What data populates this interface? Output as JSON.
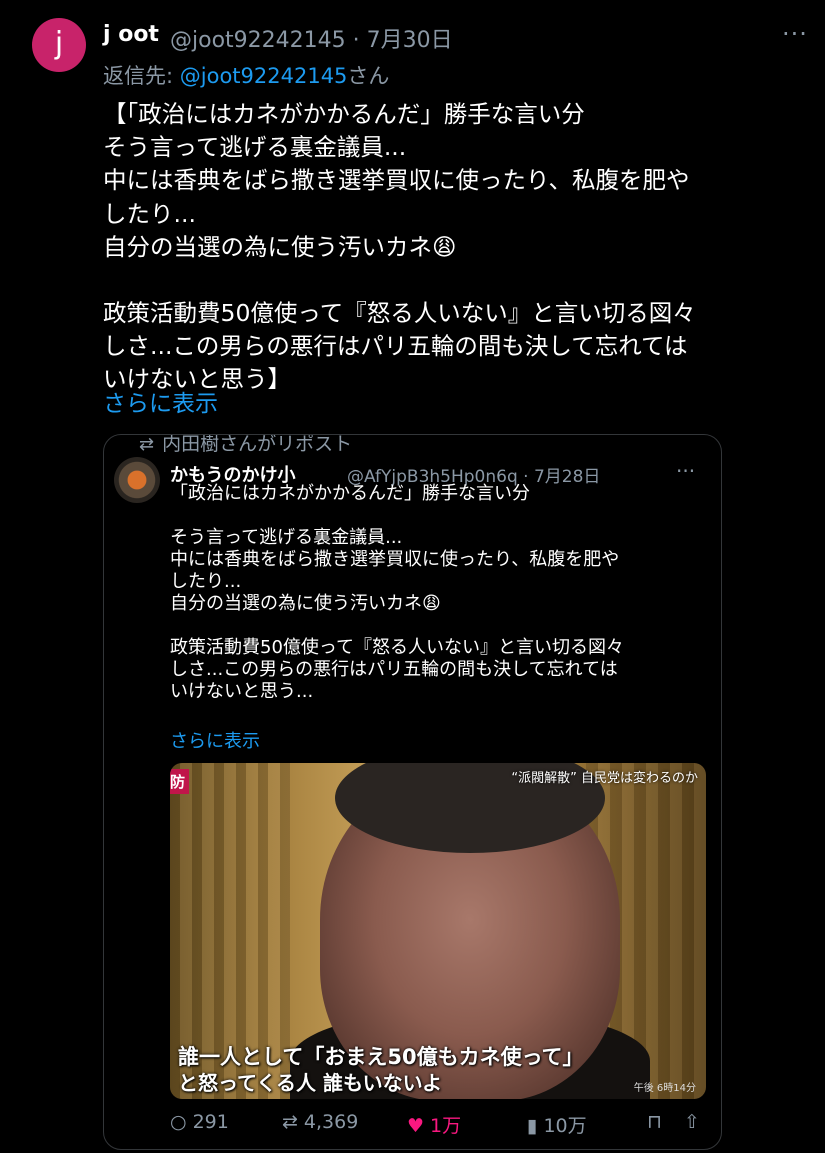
{
  "author": {
    "avatar_letter": "j",
    "name": "j oot",
    "handle": "@joot92242145",
    "date": "7月30日"
  },
  "reply": {
    "prefix": "返信先: ",
    "handle": "@joot92242145",
    "suffix": "さん"
  },
  "body_lines": [
    "【「政治にはカネがかかるんだ」勝手な言い分",
    "そう言って逃げる裏金議員...",
    "中には香典をばら撒き選挙買収に使ったり、私腹を肥や",
    "したり...",
    "自分の当選の為に使う汚いカネ😩",
    "",
    "政策活動費50億使って『怒る人いない』と言い切る図々",
    "しさ...この男らの悪行はパリ五輪の間も決して忘れては",
    "いけないと思う】"
  ],
  "show_more": "さらに表示",
  "quote": {
    "repost_label": "内田樹さんがリポスト",
    "name": "かもうのかけ小",
    "handle": "@AfYjpB3h5Hp0n6q",
    "date": "7月28日",
    "body_lines": [
      "「政治にはカネがかかるんだ」勝手な言い分",
      "",
      "そう言って逃げる裏金議員...",
      "中には香典をばら撒き選挙買収に使ったり、私腹を肥や",
      "したり...",
      "自分の当選の為に使う汚いカネ😩",
      "",
      "政策活動費50億使って『怒る人いない』と言い切る図々",
      "しさ...この男らの悪行はパリ五輪の間も決して忘れては",
      "いけないと思う..."
    ],
    "show_more": "さらに表示",
    "photo": {
      "logo": "防",
      "tag": "“派閥解散” 自民党は変わるのか",
      "subtitle_line1": "誰一人として「おまえ50億もカネ使って」",
      "subtitle_line2": "と怒ってくる人 誰もいないよ",
      "corner": "午後 6時14分"
    },
    "actions": {
      "replies": "291",
      "reposts": "4,369",
      "likes": "1万",
      "views": "10万"
    }
  },
  "colors": {
    "background": "#000000",
    "accent_link": "#1d9bf0",
    "like": "#f91880",
    "avatar": "#c8236a"
  }
}
